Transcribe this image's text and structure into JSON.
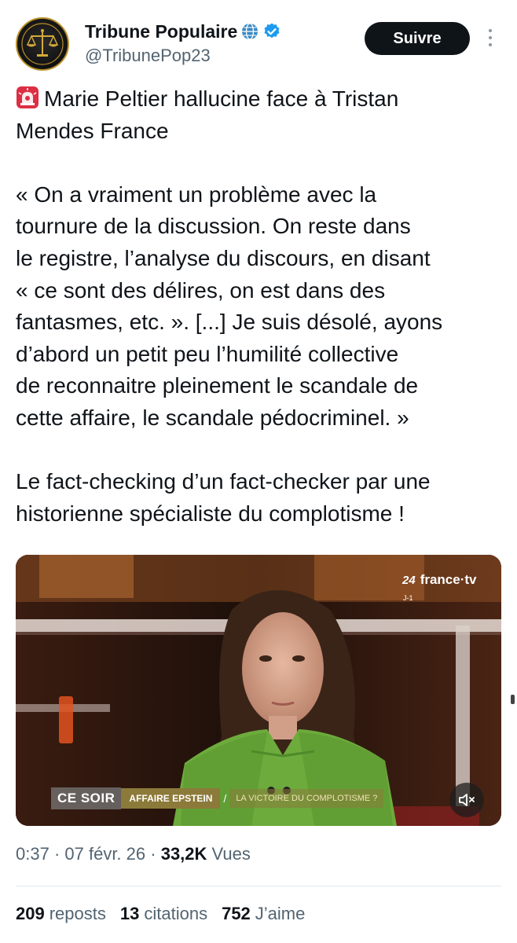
{
  "author": {
    "display_name": "Tribune Populaire",
    "handle": "@TribunePop23",
    "verified": true,
    "name_emoji_icon": "globe-icon",
    "avatar_icon": "scales-of-justice-icon"
  },
  "actions": {
    "follow_label": "Suivre",
    "more_icon": "more-vertical-icon"
  },
  "tweet": {
    "lines": [
      "Marie Peltier hallucine face à Tristan",
      "Mendes France",
      "",
      "« On a vraiment un problème avec la",
      "tournure de la discussion.  On reste dans",
      "le registre, l’analyse du discours, en disant",
      "« ce sont des délires, on est dans des",
      "fantasmes, etc. ». [...] Je suis désolé, ayons",
      "d’abord un petit peu l’humilité collective",
      "de reconnaitre pleinement le scandale de",
      "cette affaire, le scandale pédocriminel. »",
      "",
      "Le fact-checking d’un fact-checker par une",
      "historienne spécialiste du complotisme !"
    ],
    "leading_emoji_icon": "siren-icon"
  },
  "media": {
    "broadcaster": "france·tv",
    "channel_badge": "24",
    "badge_sub": "J-1",
    "show_name": "CE SOIR",
    "segment_title": "AFFAIRE EPSTEIN",
    "segment_separator": "/",
    "segment_topic": "LA VICTOIRE DU COMPLOTISME ?",
    "mute_icon": "volume-muted-icon"
  },
  "meta": {
    "time": "0:37",
    "date": "07 févr. 26",
    "views_count": "33,2K",
    "views_label": "Vues",
    "sep": " · "
  },
  "stats": [
    {
      "count": "209",
      "label": "reposts"
    },
    {
      "count": "13",
      "label": "citations"
    },
    {
      "count": "752",
      "label": "J’aime"
    }
  ],
  "colors": {
    "text": "#0f1419",
    "secondary": "#536471",
    "verified_blue": "#1d9bf0",
    "follow_bg": "#0f1419",
    "lower_third_gold": "#8c7a3a"
  }
}
